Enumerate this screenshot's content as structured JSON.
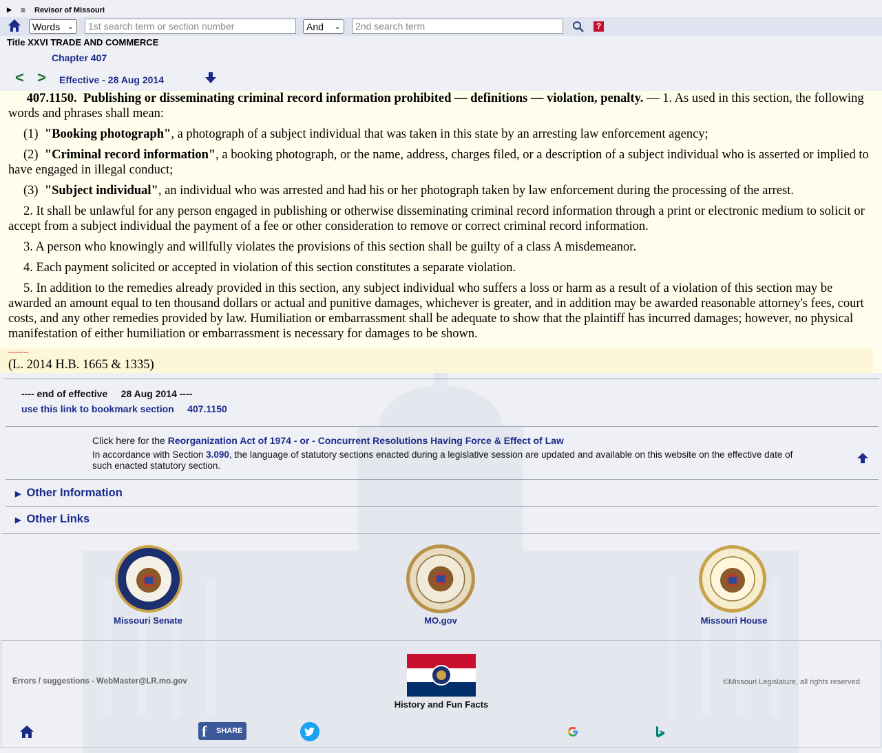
{
  "topbar": {
    "brand": "Revisor of Missouri",
    "toggle_icon": "triangle-right-icon",
    "menu_icon": "menu-icon"
  },
  "search": {
    "mode": "Words",
    "term1_placeholder": "1st search term or section number",
    "operator": "And",
    "term2_placeholder": "2nd search term",
    "help_label": "?"
  },
  "header": {
    "title": "Title XXVI TRADE AND COMMERCE",
    "chapter": "Chapter 407",
    "prev": "<",
    "next": ">",
    "effective": "Effective - 28 Aug 2014"
  },
  "statute": {
    "section_number": "407.1150.",
    "heading": "Publishing or disseminating criminal record information prohibited — definitions — violation, penalty.",
    "intro": " — 1.  As used in this section, the following words and phrases shall mean:",
    "definitions": [
      {
        "num": "(1)",
        "term": "\"Booking photograph\"",
        "text": ", a photograph of a subject individual that was taken in this state by an arresting law enforcement agency;"
      },
      {
        "num": "(2)",
        "term": "\"Criminal record information\"",
        "text": ", a booking photograph, or the name, address, charges filed, or a description of a subject individual who is asserted or implied to have engaged in illegal conduct;"
      },
      {
        "num": "(3)",
        "term": "\"Subject individual\"",
        "text": ", an individual who was arrested and had his or her photograph taken by law enforcement during the processing of the arrest."
      }
    ],
    "subsections": [
      "2.  It shall be unlawful for any person engaged in publishing or otherwise disseminating criminal record information through a print or electronic medium to solicit or accept from a subject individual the payment of a fee or other consideration to remove or correct criminal record information.",
      "3.  A person who knowingly and willfully violates the provisions of this section shall be guilty of a class A misdemeanor.",
      "4.  Each payment solicited or accepted in violation of this section constitutes a separate violation.",
      "5.  In addition to the remedies already provided in this section, any subject individual who suffers a loss or harm as a result of a violation of this section may be awarded an amount equal to ten thousand dollars or actual and punitive damages, whichever is greater, and in addition may be awarded reasonable attorney's fees, court costs, and any other remedies provided by law.  Humiliation or embarrassment shall be adequate to show that the plaintiff has incurred damages; however, no physical manifestation of either humiliation or embarrassment is necessary for damages to be shown."
    ],
    "dashes": "--------",
    "history": "(L. 2014 H.B. 1665 & 1335)"
  },
  "end_block": {
    "end_text": "---- end of effective     28 Aug 2014 ----",
    "bookmark_text": "use this link to bookmark section     407.1150"
  },
  "notice": {
    "prefix": "Click here for the ",
    "link": "Reorganization Act of 1974 - or - Concurrent Resolutions Having Force & Effect of Law",
    "accord_pre": "In accordance with Section ",
    "accord_link": "3.090",
    "accord_post": ", the language of statutory sections enacted during a legislative session are updated and available on this website on the effective date of such enacted statutory section."
  },
  "details": {
    "other_info": "Other Information",
    "other_links": "Other Links"
  },
  "seals": {
    "senate": "Missouri Senate",
    "mogov": "MO.gov",
    "house": "Missouri House"
  },
  "footer": {
    "errors": "Errors / suggestions - WebMaster@LR.mo.gov",
    "copyright": "©Missouri Legislature, all rights reserved.",
    "history_fun": "History and Fun Facts",
    "share_label": "SHARE"
  },
  "colors": {
    "link": "#1a2a8a",
    "nav_green": "#1e6b2a",
    "statute_bg": "#fffdeb",
    "fb_blue": "#3b5998",
    "twitter_blue": "#1da1f2"
  }
}
